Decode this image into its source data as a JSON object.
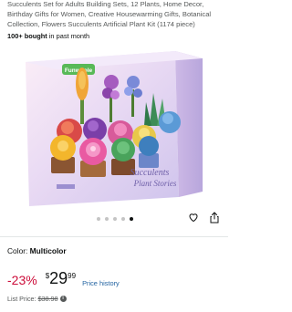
{
  "product": {
    "title": "Succulents Set for Adults Building Sets, 12 Plants, Home Decor, Birthday Gifts for Women, Creative Housewarming Gifts, Botanical Collection, Flowers Succulents Artificial Plant Kit (1174 piece)",
    "bought_count": "100+ bought",
    "bought_suffix": " in past month"
  },
  "box_art": {
    "brand": "Funwhole",
    "headline_line1": "Succulents",
    "headline_line2": "Plant Stories"
  },
  "gallery": {
    "dots": 5,
    "active_index": 4
  },
  "actions": {
    "favorite_icon": "heart-icon",
    "share_icon": "share-icon"
  },
  "variant": {
    "label": "Color: ",
    "value": "Multicolor"
  },
  "pricing": {
    "discount": "-23%",
    "currency": "$",
    "whole": "29",
    "fraction": "99",
    "history_link": "Price history",
    "list_label": "List Price:",
    "list_value": "$38.98"
  },
  "colors": {
    "discount_red": "#cc0c39",
    "link_blue": "#2162a1",
    "muted_text": "#565959"
  }
}
